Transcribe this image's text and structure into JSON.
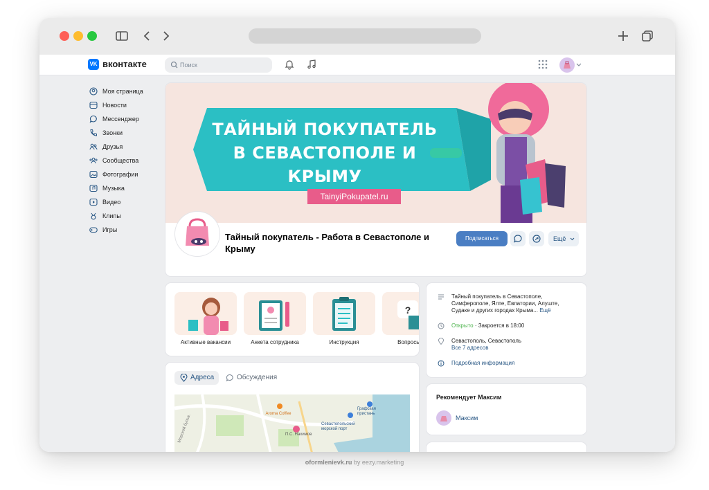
{
  "header": {
    "brand": "вконтакте",
    "logo_text": "VK",
    "search_placeholder": "Поиск"
  },
  "sidebar": {
    "items": [
      {
        "label": "Моя страница",
        "icon": "user-circle-icon"
      },
      {
        "label": "Новости",
        "icon": "news-icon"
      },
      {
        "label": "Мессенджер",
        "icon": "message-icon"
      },
      {
        "label": "Звонки",
        "icon": "phone-icon"
      },
      {
        "label": "Друзья",
        "icon": "friends-icon"
      },
      {
        "label": "Сообщества",
        "icon": "communities-icon"
      },
      {
        "label": "Фотографии",
        "icon": "photo-icon"
      },
      {
        "label": "Музыка",
        "icon": "music-icon"
      },
      {
        "label": "Видео",
        "icon": "video-icon"
      },
      {
        "label": "Клипы",
        "icon": "clips-icon"
      },
      {
        "label": "Игры",
        "icon": "gamepad-icon"
      }
    ]
  },
  "cover": {
    "title_line1": "ТАЙНЫЙ ПОКУПАТЕЛЬ",
    "title_line2": "В СЕВАСТОПОЛЕ И КРЫМУ",
    "url": "TainyiPokupatel.ru",
    "colors": {
      "banner": "#2bbfc4",
      "background": "#f6e5df",
      "url_badge": "#e85c8a"
    }
  },
  "group": {
    "name": "Тайный покупатель - Работа в Севастополе и Крыму",
    "subscribe_label": "Подписаться",
    "more_label": "Ещё"
  },
  "tiles": [
    {
      "label": "Активные вакансии"
    },
    {
      "label": "Анкета сотрудника"
    },
    {
      "label": "Инструкция"
    },
    {
      "label": "Вопросы / О"
    }
  ],
  "map_section": {
    "tab_addresses": "Адреса",
    "tab_discussions": "Обсуждения",
    "map_labels": {
      "cafe": "Aroma Coffee",
      "pier": "Графская\nпристань",
      "port": "Севастопольский\nморской порт",
      "square": "П.С. Нахимов",
      "street": "Морской бульв."
    }
  },
  "info": {
    "description": "Тайный покупатель в Севастополе, Симферополе, Ялте, Евпатории, Алуште, Судаке и других городах Крыма...",
    "description_more": "Ещё",
    "status_open": "Открыто",
    "status_rest": " · Закроется в 18:00",
    "address": "Севастополь, Севастополь",
    "all_addresses": "Все 7 адресов",
    "details": "Подробная информация"
  },
  "recommend": {
    "title": "Рекомендует Максим",
    "person": "Максим"
  },
  "footer": {
    "site": "oformlenievk.ru",
    "by": " by eezy.marketing"
  },
  "colors": {
    "vk_blue": "#0077ff",
    "link": "#2a5885",
    "button": "#4a7ec3",
    "page_bg": "#edeef0",
    "traffic_red": "#fe5f57",
    "traffic_yellow": "#febc2e",
    "traffic_green": "#28c840"
  }
}
